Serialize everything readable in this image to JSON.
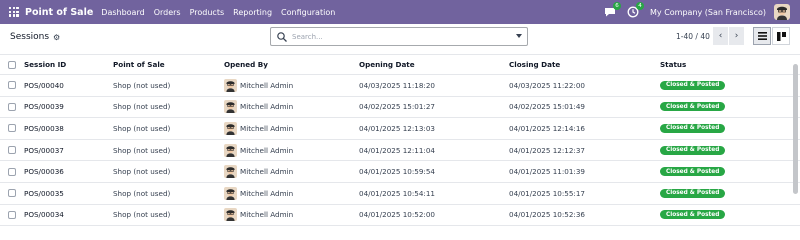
{
  "topbar": {
    "app_title": "Point of Sale",
    "menu": [
      "Dashboard",
      "Orders",
      "Products",
      "Reporting",
      "Configuration"
    ],
    "chat_badge": "6",
    "activity_badge": "4",
    "company": "My Company (San Francisco)",
    "bg_color": "#71639e"
  },
  "controlbar": {
    "breadcrumb": "Sessions",
    "search_placeholder": "Search...",
    "pager": "1-40 / 40"
  },
  "table": {
    "headers": [
      "Session ID",
      "Point of Sale",
      "Opened By",
      "Opening Date",
      "Closing Date",
      "Status"
    ],
    "rows": [
      {
        "id": "POS/00040",
        "pos": "Shop (not used)",
        "user": "Mitchell Admin",
        "open": "04/03/2025 11:18:20",
        "close": "04/03/2025 11:22:00",
        "status": "Closed & Posted"
      },
      {
        "id": "POS/00039",
        "pos": "Shop (not used)",
        "user": "Mitchell Admin",
        "open": "04/02/2025 15:01:27",
        "close": "04/02/2025 15:01:49",
        "status": "Closed & Posted"
      },
      {
        "id": "POS/00038",
        "pos": "Shop (not used)",
        "user": "Mitchell Admin",
        "open": "04/01/2025 12:13:03",
        "close": "04/01/2025 12:14:16",
        "status": "Closed & Posted"
      },
      {
        "id": "POS/00037",
        "pos": "Shop (not used)",
        "user": "Mitchell Admin",
        "open": "04/01/2025 12:11:04",
        "close": "04/01/2025 12:12:37",
        "status": "Closed & Posted"
      },
      {
        "id": "POS/00036",
        "pos": "Shop (not used)",
        "user": "Mitchell Admin",
        "open": "04/01/2025 10:59:54",
        "close": "04/01/2025 11:01:39",
        "status": "Closed & Posted"
      },
      {
        "id": "POS/00035",
        "pos": "Shop (not used)",
        "user": "Mitchell Admin",
        "open": "04/01/2025 10:54:11",
        "close": "04/01/2025 10:55:17",
        "status": "Closed & Posted"
      },
      {
        "id": "POS/00034",
        "pos": "Shop (not used)",
        "user": "Mitchell Admin",
        "open": "04/01/2025 10:52:00",
        "close": "04/01/2025 10:52:36",
        "status": "Closed & Posted"
      }
    ],
    "status_color": "#28a745"
  }
}
